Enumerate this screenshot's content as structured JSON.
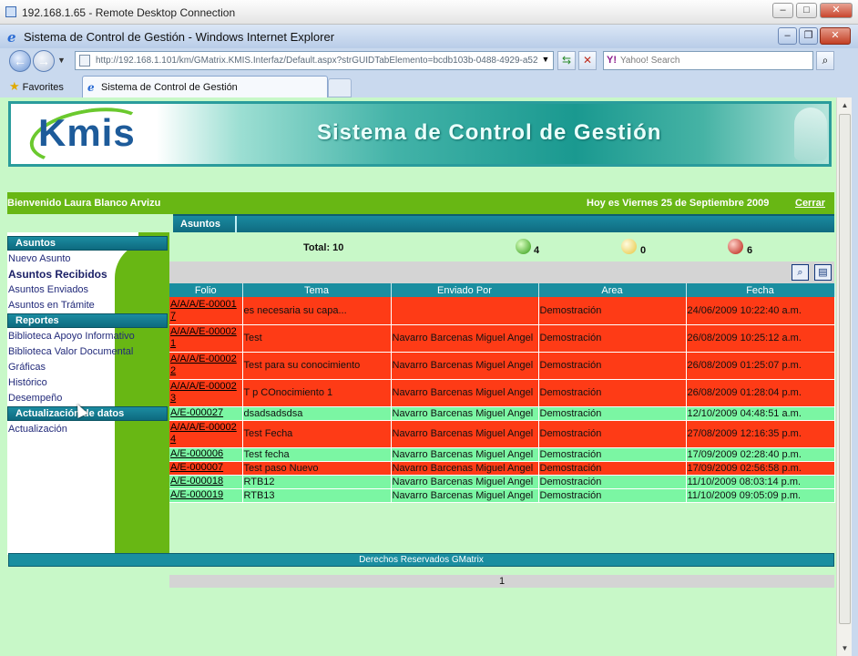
{
  "rdp": {
    "title": "192.168.1.65 - Remote Desktop Connection"
  },
  "ie": {
    "title": "Sistema de Control de Gestión - Windows Internet Explorer",
    "address": "http://192.168.1.101/km/GMatrix.KMIS.Interfaz/Default.aspx?strGUIDTabElemento=bcdb103b-0488-4929-a52",
    "search_placeholder": "Yahoo! Search",
    "favorites_label": "Favorites",
    "tab_label": "Sistema de Control de Gestión"
  },
  "banner": {
    "logo": "Kmis",
    "title": "Sistema de Control de Gestión"
  },
  "header": {
    "welcome": "Bienvenido Laura Blanco Arvizu",
    "date": "Hoy es Viernes 25 de Septiembre 2009",
    "logout": "Cerrar"
  },
  "tabs": {
    "active": "Asuntos"
  },
  "sidebar": {
    "sections": [
      {
        "title": "Asuntos",
        "items": [
          "Nuevo Asunto",
          "Asuntos Recibidos",
          "Asuntos Enviados",
          "Asuntos en Trámite"
        ]
      },
      {
        "title": "Reportes",
        "items": [
          "Biblioteca Apoyo Informativo",
          "Biblioteca Valor Documental",
          "Gráficas",
          "Histórico",
          "Desempeño"
        ]
      },
      {
        "title": "Actualización de datos",
        "items": [
          "Actualización"
        ]
      }
    ]
  },
  "summary": {
    "total": "Total: 10",
    "green": "4",
    "yellow": "0",
    "red": "6"
  },
  "table": {
    "headers": [
      "Folio",
      "Tema",
      "Enviado Por",
      "Area",
      "Fecha"
    ],
    "rows": [
      {
        "status": "red",
        "folio": "A/A/A/E-000017",
        "tema": "es necesaria su capa...",
        "enviado": "",
        "area": "Demostración",
        "fecha": "24/06/2009 10:22:40 a.m."
      },
      {
        "status": "red",
        "folio": "A/A/A/E-000021",
        "tema": "Test",
        "enviado": "Navarro Barcenas Miguel Angel",
        "area": "Demostración",
        "fecha": "26/08/2009 10:25:12 a.m."
      },
      {
        "status": "red",
        "folio": "A/A/A/E-000022",
        "tema": "Test para su conocimiento",
        "enviado": "Navarro Barcenas Miguel Angel",
        "area": "Demostración",
        "fecha": "26/08/2009 01:25:07 p.m."
      },
      {
        "status": "red",
        "folio": "A/A/A/E-000023",
        "tema": "T p COnocimiento 1",
        "enviado": "Navarro Barcenas Miguel Angel",
        "area": "Demostración",
        "fecha": "26/08/2009 01:28:04 p.m."
      },
      {
        "status": "green",
        "folio": "A/E-000027",
        "tema": "dsadsadsdsa",
        "enviado": "Navarro Barcenas Miguel Angel",
        "area": "Demostración",
        "fecha": "12/10/2009 04:48:51 a.m."
      },
      {
        "status": "red",
        "folio": "A/A/A/E-000024",
        "tema": "Test Fecha",
        "enviado": "Navarro Barcenas Miguel Angel",
        "area": "Demostración",
        "fecha": "27/08/2009 12:16:35 p.m."
      },
      {
        "status": "green",
        "folio": "A/E-000006",
        "tema": "Test fecha",
        "enviado": "Navarro Barcenas Miguel Angel",
        "area": "Demostración",
        "fecha": "17/09/2009 02:28:40 p.m."
      },
      {
        "status": "red",
        "folio": "A/E-000007",
        "tema": "Test paso Nuevo",
        "enviado": "Navarro Barcenas Miguel Angel",
        "area": "Demostración",
        "fecha": "17/09/2009 02:56:58 p.m."
      },
      {
        "status": "green",
        "folio": "A/E-000018",
        "tema": "RTB12",
        "enviado": "Navarro Barcenas Miguel Angel",
        "area": "Demostración",
        "fecha": "11/10/2009 08:03:14 p.m."
      },
      {
        "status": "green",
        "folio": "A/E-000019",
        "tema": "RTB13",
        "enviado": "Navarro Barcenas Miguel Angel",
        "area": "Demostración",
        "fecha": "11/10/2009 09:05:09 p.m."
      }
    ],
    "page": "1"
  },
  "footer": "Derechos Reservados GMatrix",
  "colors": {
    "red_row": "#fe3b16",
    "green_row": "#7bf6a3",
    "header_teal": "#1a8ea0",
    "sidebar_green": "#68b714",
    "background": "#c8f8c8"
  }
}
